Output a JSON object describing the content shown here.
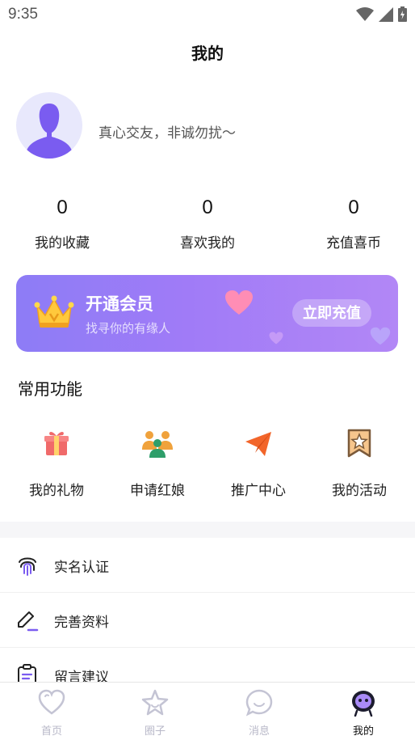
{
  "status_bar": {
    "time": "9:35"
  },
  "header": {
    "title": "我的"
  },
  "profile": {
    "signature": "真心交友，非诚勿扰～"
  },
  "stats": [
    {
      "value": "0",
      "label": "我的收藏"
    },
    {
      "value": "0",
      "label": "喜欢我的"
    },
    {
      "value": "0",
      "label": "充值喜币"
    }
  ],
  "vip": {
    "title": "开通会员",
    "subtitle": "找寻你的有缘人",
    "button": "立即充值"
  },
  "features": {
    "title": "常用功能",
    "items": [
      {
        "label": "我的礼物",
        "icon": "gift-icon"
      },
      {
        "label": "申请红娘",
        "icon": "people-icon"
      },
      {
        "label": "推广中心",
        "icon": "paper-plane-icon"
      },
      {
        "label": "我的活动",
        "icon": "bookmark-star-icon"
      }
    ]
  },
  "menu": [
    {
      "label": "实名认证",
      "icon": "fingerprint-icon"
    },
    {
      "label": "完善资料",
      "icon": "edit-icon"
    },
    {
      "label": "留言建议",
      "icon": "note-icon"
    }
  ],
  "bottom_nav": [
    {
      "label": "首页",
      "icon": "heart-icon",
      "active": false
    },
    {
      "label": "圈子",
      "icon": "star-icon",
      "active": false
    },
    {
      "label": "消息",
      "icon": "chat-icon",
      "active": false
    },
    {
      "label": "我的",
      "icon": "robot-face-icon",
      "active": true
    }
  ],
  "colors": {
    "accent": "#9b7bf7",
    "accent_dark": "#7b5cf0",
    "gift": "#f06a6a",
    "people": "#f0a23c",
    "plane": "#f2652a",
    "activity": "#e8954a"
  }
}
